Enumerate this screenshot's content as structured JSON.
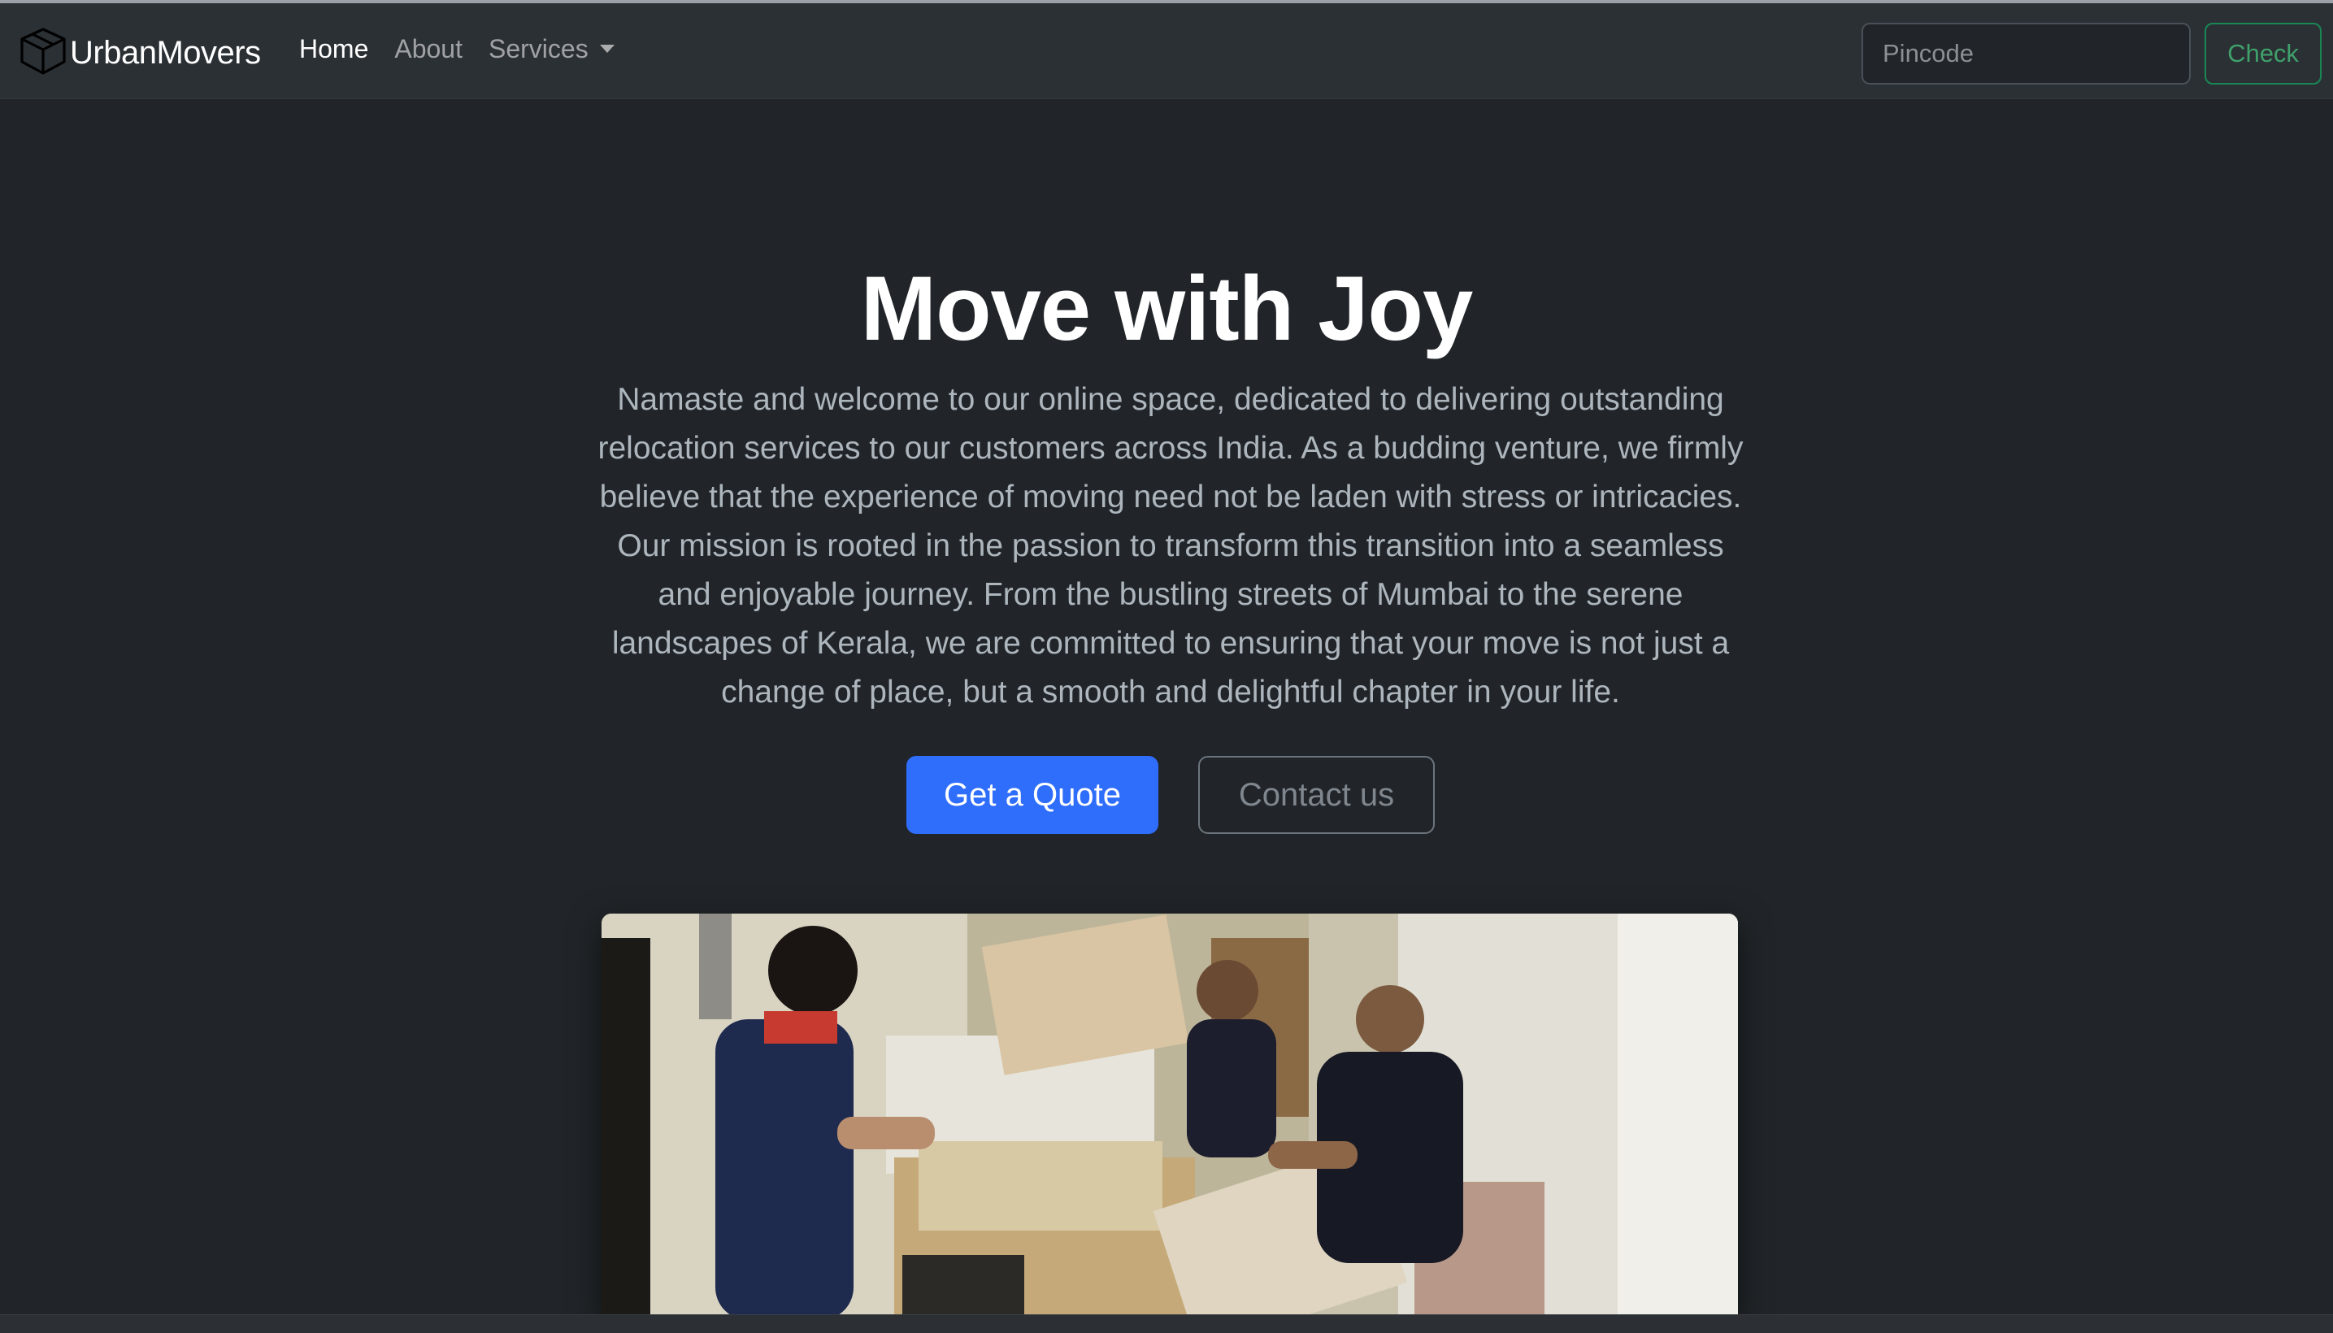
{
  "navbar": {
    "brand": "UrbanMovers",
    "links": [
      {
        "label": "Home",
        "active": true
      },
      {
        "label": "About",
        "active": false
      },
      {
        "label": "Services",
        "active": false,
        "dropdown": true
      }
    ],
    "search": {
      "placeholder": "Pincode",
      "value": ""
    },
    "check_label": "Check"
  },
  "hero": {
    "title": "Move with Joy",
    "lead": "Namaste and welcome to our online space, dedicated to delivering outstanding relocation services to our customers across India. As a budding venture, we firmly believe that the experience of moving need not be laden with stress or intricacies. Our mission is rooted in the passion to transform this transition into a seamless and enjoyable journey. From the bustling streets of Mumbai to the serene landscapes of Kerala, we are committed to ensuring that your move is not just a change of place, but a smooth and delightful chapter in your life.",
    "primary_button": "Get a Quote",
    "secondary_button": "Contact us"
  },
  "icons": {
    "brand": "box-icon",
    "dropdown": "caret-down-icon"
  },
  "colors": {
    "page_bg": "#212529",
    "navbar_bg": "#2b3035",
    "primary": "#2f6dfb",
    "success": "#198754",
    "muted_text": "#adb5bd"
  }
}
